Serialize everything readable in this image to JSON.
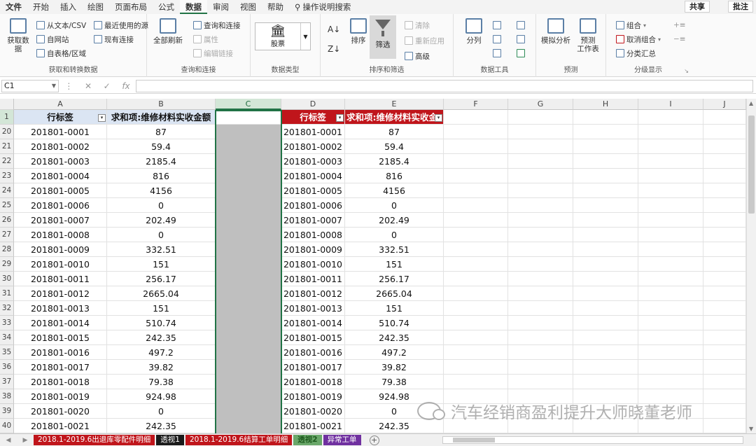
{
  "ribbon_tabs": [
    {
      "label": "文件",
      "kind": "file"
    },
    {
      "label": "开始"
    },
    {
      "label": "插入"
    },
    {
      "label": "绘图"
    },
    {
      "label": "页面布局"
    },
    {
      "label": "公式"
    },
    {
      "label": "数据",
      "active": true
    },
    {
      "label": "审阅"
    },
    {
      "label": "视图"
    },
    {
      "label": "帮助"
    },
    {
      "label": "操作说明搜索",
      "kind": "search"
    }
  ],
  "share_label": "共享",
  "comment_label": "批注",
  "groups": {
    "get_data": {
      "label": "获取和转换数据",
      "big": "获取数据",
      "items": [
        "从文本/CSV",
        "自网站",
        "自表格/区域",
        "最近使用的源",
        "现有连接"
      ]
    },
    "queries": {
      "label": "查询和连接",
      "big": "全部刷新",
      "items": [
        "查询和连接",
        "属性",
        "编辑链接"
      ]
    },
    "data_types": {
      "label": "数据类型",
      "stocks": "股票"
    },
    "sort_filter": {
      "label": "排序和筛选",
      "sort": "排序",
      "filter": "筛选",
      "items": [
        "清除",
        "重新应用",
        "高级"
      ]
    },
    "data_tools": {
      "label": "数据工具",
      "split": "分列"
    },
    "forecast": {
      "label": "预测",
      "whatif": "模拟分析",
      "sheet": "预测\n工作表"
    },
    "outline": {
      "label": "分级显示",
      "items": [
        "组合",
        "取消组合",
        "分类汇总"
      ]
    }
  },
  "name_box": "C1",
  "fx_label": "fx",
  "columns": [
    "A",
    "B",
    "C",
    "D",
    "E",
    "F",
    "G",
    "H",
    "I",
    "J"
  ],
  "headers": {
    "row_label": "行标签",
    "sum_label": "求和项:维修材料实收金额",
    "sum_label_short": "求和项:维修材料实收金"
  },
  "row_numbers": [
    "1",
    "20",
    "21",
    "22",
    "23",
    "24",
    "25",
    "26",
    "27",
    "28",
    "29",
    "30",
    "31",
    "32",
    "33",
    "34",
    "35",
    "36",
    "37",
    "38",
    "39",
    "40"
  ],
  "rows": [
    [
      "201801-0001",
      "87"
    ],
    [
      "201801-0002",
      "59.4"
    ],
    [
      "201801-0003",
      "2185.4"
    ],
    [
      "201801-0004",
      "816"
    ],
    [
      "201801-0005",
      "4156"
    ],
    [
      "201801-0006",
      "0"
    ],
    [
      "201801-0007",
      "202.49"
    ],
    [
      "201801-0008",
      "0"
    ],
    [
      "201801-0009",
      "332.51"
    ],
    [
      "201801-0010",
      "151"
    ],
    [
      "201801-0011",
      "256.17"
    ],
    [
      "201801-0012",
      "2665.04"
    ],
    [
      "201801-0013",
      "151"
    ],
    [
      "201801-0014",
      "510.74"
    ],
    [
      "201801-0015",
      "242.35"
    ],
    [
      "201801-0016",
      "497.2"
    ],
    [
      "201801-0017",
      "39.82"
    ],
    [
      "201801-0018",
      "79.38"
    ],
    [
      "201801-0019",
      "924.98"
    ],
    [
      "201801-0020",
      "0"
    ],
    [
      "201801-0021",
      "242.35"
    ]
  ],
  "sheet_tabs": [
    {
      "label": "2018.1-2019.6出退库零配件明细",
      "color": "#c0151b"
    },
    {
      "label": "透视1",
      "color": "#1a1a1a"
    },
    {
      "label": "2018.1-2019.6结算工单明细",
      "color": "#c0151b"
    },
    {
      "label": "透视2",
      "color": "#6aa86a",
      "active": true
    },
    {
      "label": "异常工单",
      "color": "#7030a0"
    }
  ],
  "watermark": "汽车经销商盈利提升大师晓董老师"
}
